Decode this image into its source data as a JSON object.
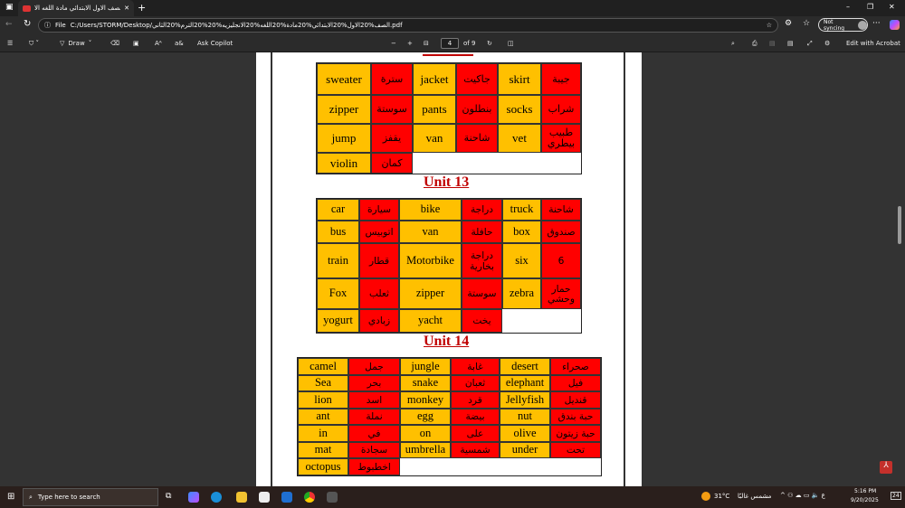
{
  "browser": {
    "tab_title": "الصف الاول الابتدائي مادة اللغه الا",
    "new_tab": "+",
    "address_label": "File",
    "address": "C:/Users/STORM/Desktop/الصف%20الاول%20الابتدائي%20مادة%20اللغه%20الانجليزيه%20%20الترم%20الثاني.pdf",
    "not_syncing": "Not syncing",
    "min": "–",
    "max": "❐",
    "close": "✕"
  },
  "pdf_toolbar": {
    "draw": "Draw",
    "ask_copilot": "Ask Copilot",
    "page_current": "4",
    "page_total": "of 9",
    "edit_acrobat": "Edit with Acrobat",
    "zoom_out": "−",
    "zoom_in": "+"
  },
  "document": {
    "table1": {
      "rows": [
        [
          "sweater",
          "سترة",
          "jacket",
          "جاكيت",
          "skirt",
          "جيبة"
        ],
        [
          "zipper",
          "سوستة",
          "pants",
          "بنطلون",
          "socks",
          "شراب"
        ],
        [
          "jump",
          "يقفز",
          "van",
          "شاحنة",
          "vet",
          "طبيب بيطري"
        ],
        [
          "violin",
          "كمان"
        ]
      ]
    },
    "unit13": {
      "title": "Unit 13",
      "rows": [
        [
          "car",
          "سيارة",
          "bike",
          "دراجة",
          "truck",
          "شاحنة"
        ],
        [
          "bus",
          "اتوبيس",
          "van",
          "حافلة",
          "box",
          "صندوق"
        ],
        [
          "train",
          "قطار",
          "Motorbike",
          "دراجة بخارية",
          "six",
          "6"
        ],
        [
          "Fox",
          "ثعلب",
          "zipper",
          "سوستة",
          "zebra",
          "حمار وحشي"
        ],
        [
          "yogurt",
          "زبادي",
          "yacht",
          "يخت"
        ]
      ]
    },
    "unit14": {
      "title": "Unit 14",
      "rows": [
        [
          "camel",
          "جمل",
          "jungle",
          "غابة",
          "desert",
          "صحراء"
        ],
        [
          "Sea",
          "بحر",
          "snake",
          "ثعبان",
          "elephant",
          "فيل"
        ],
        [
          "lion",
          "اسد",
          "monkey",
          "قرد",
          "Jellyfish",
          "قنديل"
        ],
        [
          "ant",
          "نملة",
          "egg",
          "بيضة",
          "nut",
          "حبة بندق"
        ],
        [
          "in",
          "في",
          "on",
          "على",
          "olive",
          "حبة زيتون"
        ],
        [
          "mat",
          "سجادة",
          "umbrella",
          "شمسية",
          "under",
          "تحت"
        ],
        [
          "octopus",
          "اخطبوط"
        ]
      ]
    }
  },
  "taskbar": {
    "search_placeholder": "Type here to search",
    "weather": "31°C",
    "weather_desc": "مشمس غالبًا",
    "time": "5:16 PM",
    "date": "9/20/2025",
    "notif_count": "24"
  },
  "colors": {
    "english_cell": "#FFC000",
    "arabic_cell": "#FF0000",
    "unit_title": "#C00000"
  }
}
